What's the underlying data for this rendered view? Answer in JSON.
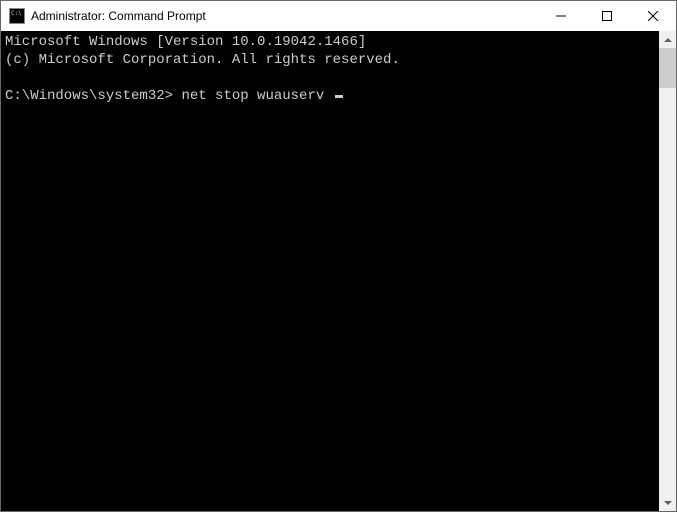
{
  "window": {
    "title": "Administrator: Command Prompt"
  },
  "terminal": {
    "header_line1": "Microsoft Windows [Version 10.0.19042.1466]",
    "header_line2": "(c) Microsoft Corporation. All rights reserved.",
    "prompt": "C:\\Windows\\system32>",
    "command": "net stop wuauserv"
  }
}
